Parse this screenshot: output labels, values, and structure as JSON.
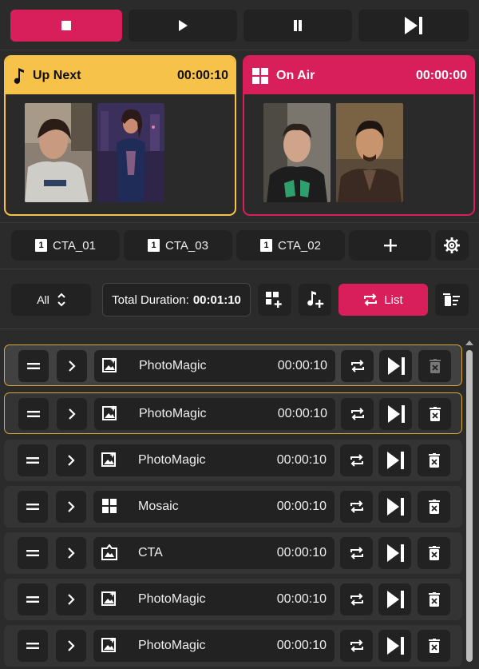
{
  "panels": {
    "up_next": {
      "title": "Up Next",
      "time": "00:00:10",
      "color": "#f7c24a"
    },
    "on_air": {
      "title": "On Air",
      "time": "00:00:00",
      "color": "#d81e5b"
    }
  },
  "cta_buttons": [
    {
      "num": "1",
      "label": "CTA_01"
    },
    {
      "num": "1",
      "label": "CTA_03"
    },
    {
      "num": "1",
      "label": "CTA_02"
    }
  ],
  "toolbar": {
    "filter": "All",
    "total_label": "Total Duration:",
    "total_value": "00:01:10",
    "mode_label": "List"
  },
  "playlist": [
    {
      "name": "PhotoMagic",
      "duration": "00:00:10",
      "icon": "photo-magic-icon"
    },
    {
      "name": "PhotoMagic",
      "duration": "00:00:10",
      "icon": "photo-magic-icon"
    },
    {
      "name": "PhotoMagic",
      "duration": "00:00:10",
      "icon": "photo-magic-icon"
    },
    {
      "name": "Mosaic",
      "duration": "00:00:10",
      "icon": "mosaic-icon"
    },
    {
      "name": "CTA",
      "duration": "00:00:10",
      "icon": "cta-icon"
    },
    {
      "name": "PhotoMagic",
      "duration": "00:00:10",
      "icon": "photo-magic-icon"
    },
    {
      "name": "PhotoMagic",
      "duration": "00:00:10",
      "icon": "photo-magic-icon"
    }
  ]
}
